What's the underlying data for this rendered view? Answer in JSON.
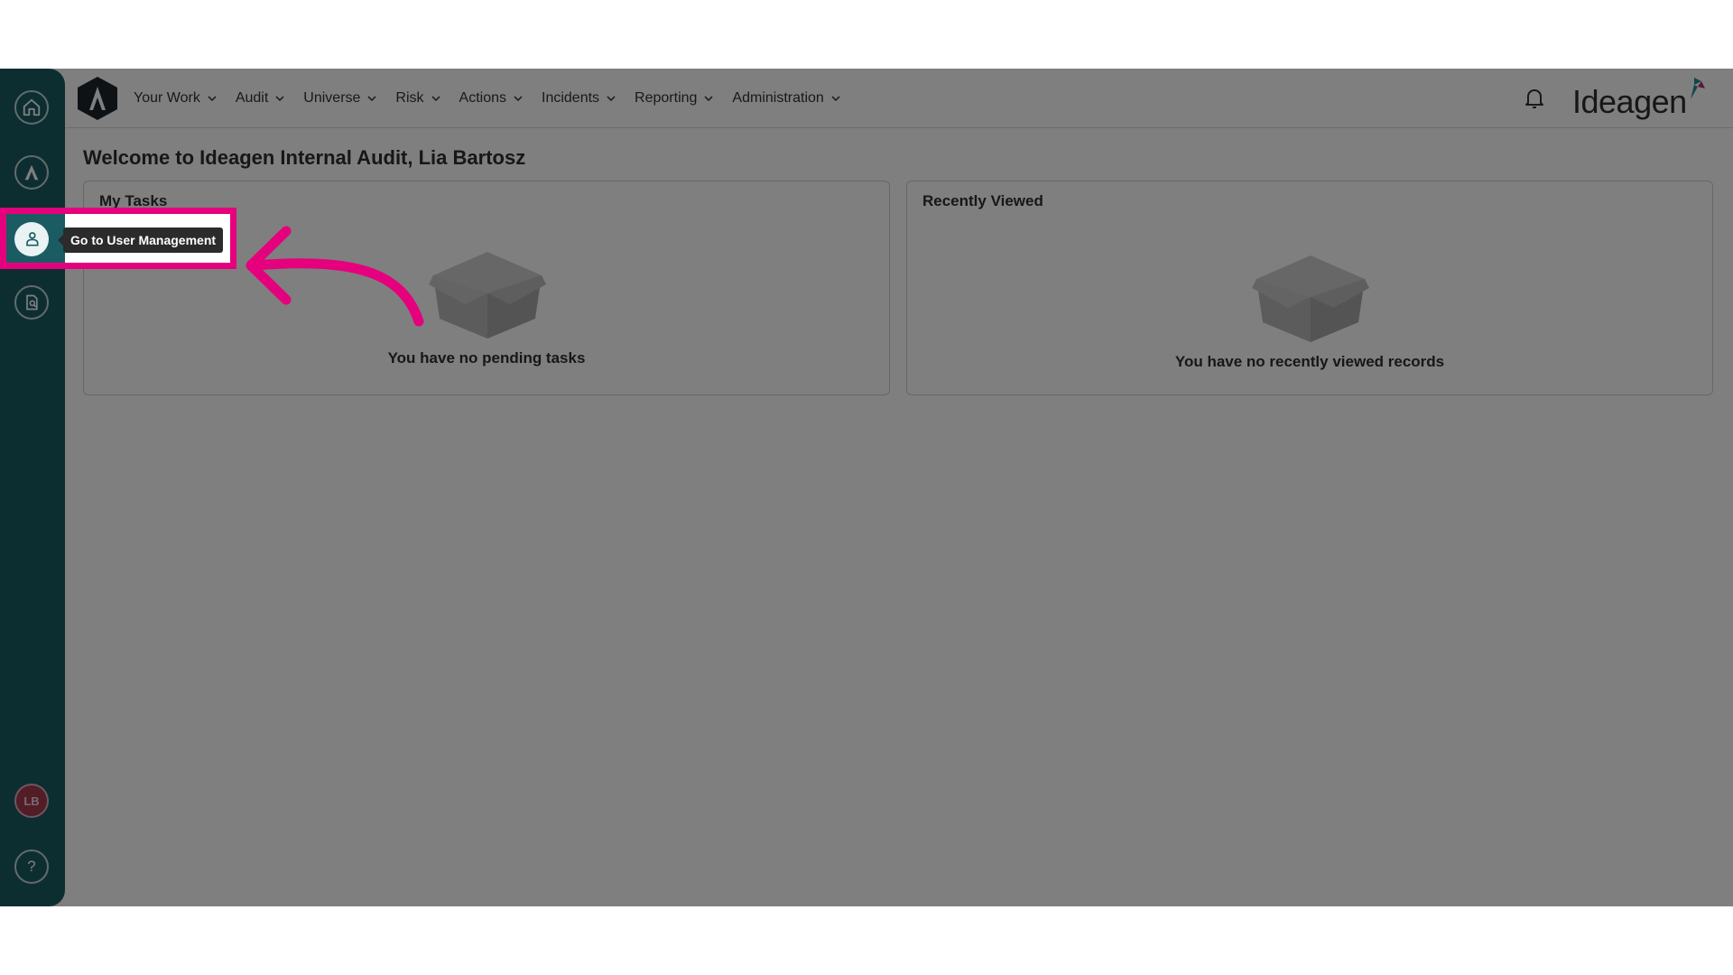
{
  "sidebar": {
    "items": [
      {
        "icon": "home-icon"
      },
      {
        "icon": "audit-logo-icon"
      },
      {
        "icon": "user-management-icon",
        "tooltip": "Go to User Management"
      },
      {
        "icon": "document-search-icon"
      }
    ],
    "avatar_initials": "LB",
    "help_label": "?"
  },
  "topbar": {
    "nav": [
      {
        "label": "Your Work"
      },
      {
        "label": "Audit"
      },
      {
        "label": "Universe"
      },
      {
        "label": "Risk"
      },
      {
        "label": "Actions"
      },
      {
        "label": "Incidents"
      },
      {
        "label": "Reporting"
      },
      {
        "label": "Administration"
      }
    ],
    "brand": "Ideagen",
    "app_logo_letter": "A"
  },
  "main": {
    "welcome": "Welcome to Ideagen Internal Audit, Lia Bartosz",
    "my_tasks": {
      "title": "My Tasks",
      "empty_text": "You have no pending tasks"
    },
    "recently_viewed": {
      "title": "Recently Viewed",
      "empty_text": "You have no recently viewed records"
    }
  },
  "colors": {
    "sidebar": "#1b5c63",
    "highlight": "#e5007d",
    "avatar": "#a53a4e",
    "tooltip": "#2b2b2b"
  }
}
